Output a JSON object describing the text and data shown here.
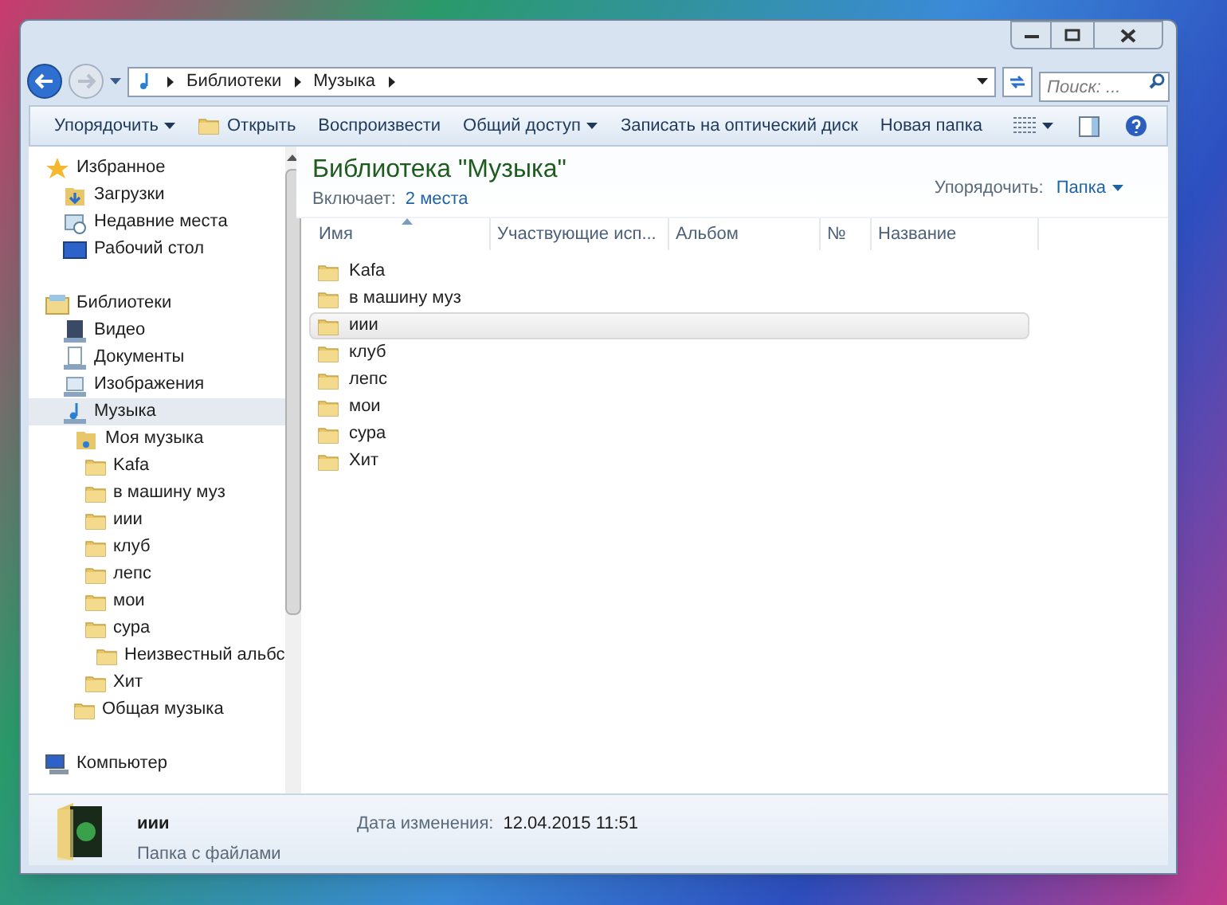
{
  "nav": {
    "back_disabled": false,
    "forward_disabled": true
  },
  "breadcrumb": [
    "Библиотеки",
    "Музыка"
  ],
  "search": {
    "placeholder": "Поиск: ..."
  },
  "toolbar": [
    {
      "label": "Упорядочить",
      "kind": "menu"
    },
    {
      "label": "Открыть",
      "kind": "icon"
    },
    {
      "label": "Воспроизвести",
      "kind": "plain"
    },
    {
      "label": "Общий доступ",
      "kind": "menu"
    },
    {
      "label": "Записать на оптический диск",
      "kind": "plain"
    },
    {
      "label": "Новая папка",
      "kind": "plain"
    }
  ],
  "sidebar": [
    {
      "label": "Избранное",
      "kind": "star",
      "selected": false,
      "children": [
        {
          "label": "Загрузки",
          "kind": "downloads",
          "selected": false
        },
        {
          "label": "Недавние места",
          "kind": "recent",
          "selected": false
        },
        {
          "label": "Рабочий стол",
          "kind": "desktop",
          "selected": false
        }
      ]
    },
    {
      "label": "Библиотеки",
      "kind": "libraries",
      "selected": false,
      "children": [
        {
          "label": "Видео",
          "kind": "video",
          "selected": false
        },
        {
          "label": "Документы",
          "kind": "documents",
          "selected": false
        },
        {
          "label": "Изображения",
          "kind": "pictures",
          "selected": false
        },
        {
          "label": "Музыка",
          "kind": "music",
          "selected": true,
          "children": [
            {
              "label": "Моя музыка",
              "kind": "music-folder",
              "selected": false,
              "children": [
                {
                  "label": "Kafa",
                  "kind": "folder",
                  "selected": false
                },
                {
                  "label": "в машину муз",
                  "kind": "folder",
                  "selected": false
                },
                {
                  "label": "иии",
                  "kind": "folder",
                  "selected": false
                },
                {
                  "label": "клуб",
                  "kind": "folder",
                  "selected": false
                },
                {
                  "label": "лепс",
                  "kind": "folder",
                  "selected": false
                },
                {
                  "label": "мои",
                  "kind": "folder",
                  "selected": false
                },
                {
                  "label": "сура",
                  "kind": "folder",
                  "selected": false,
                  "children": [
                    {
                      "label": "Неизвестный альбс",
                      "kind": "folder",
                      "selected": false
                    }
                  ]
                },
                {
                  "label": "Хит",
                  "kind": "folder",
                  "selected": false
                }
              ]
            },
            {
              "label": "Общая музыка",
              "kind": "folder",
              "selected": false
            }
          ]
        }
      ]
    },
    {
      "label": "Компьютер",
      "kind": "computer",
      "selected": false
    }
  ],
  "library": {
    "title": "Библиотека \"Музыка\"",
    "includes_label": "Включает:",
    "includes_link": "2 места",
    "arrange_label": "Упорядочить:",
    "arrange_value": "Папка"
  },
  "columns": [
    {
      "label": "Имя",
      "sorted": true
    },
    {
      "label": "Участвующие исп...",
      "sorted": false
    },
    {
      "label": "Альбом",
      "sorted": false
    },
    {
      "label": "№",
      "sorted": false
    },
    {
      "label": "Название",
      "sorted": false
    }
  ],
  "rows": [
    {
      "name": "Kafa",
      "selected": false
    },
    {
      "name": "в машину муз",
      "selected": false
    },
    {
      "name": "иии",
      "selected": true
    },
    {
      "name": "клуб",
      "selected": false
    },
    {
      "name": "лепс",
      "selected": false
    },
    {
      "name": "мои",
      "selected": false
    },
    {
      "name": "сура",
      "selected": false
    },
    {
      "name": "Хит",
      "selected": false
    }
  ],
  "details": {
    "name": "иии",
    "type": "Папка с файлами",
    "date_label": "Дата изменения:",
    "date": "12.04.2015 11:51"
  }
}
